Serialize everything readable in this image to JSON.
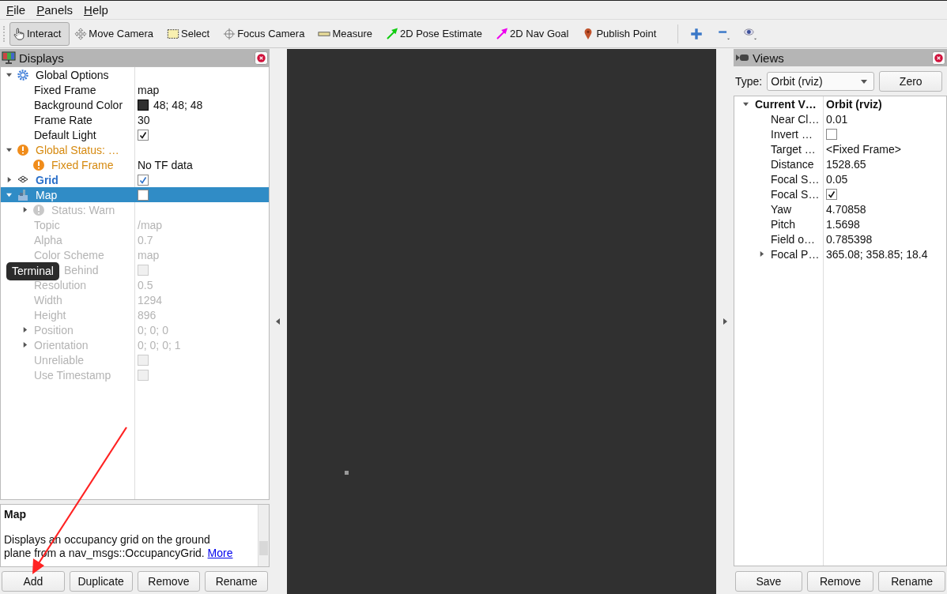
{
  "menu": [
    "File",
    "Panels",
    "Help"
  ],
  "toolbar": {
    "tools": [
      {
        "label": "Interact",
        "selected": true
      },
      {
        "label": "Move Camera",
        "selected": false
      },
      {
        "label": "Select",
        "selected": false
      },
      {
        "label": "Focus Camera",
        "selected": false
      },
      {
        "label": "Measure",
        "selected": false
      },
      {
        "label": "2D Pose Estimate",
        "selected": false
      },
      {
        "label": "2D Nav Goal",
        "selected": false
      },
      {
        "label": "Publish Point",
        "selected": false
      }
    ]
  },
  "displays_panel": {
    "title": "Displays",
    "tree": [
      {
        "kind": "group",
        "label": "Global Options",
        "expanded": true,
        "children": [
          {
            "kind": "property",
            "label": "Fixed Frame",
            "value": "map"
          },
          {
            "kind": "property",
            "label": "Background Color",
            "value": "48; 48; 48",
            "color": "#303030"
          },
          {
            "kind": "property",
            "label": "Frame Rate",
            "value": "30"
          },
          {
            "kind": "property",
            "label": "Default Light",
            "checked": true
          }
        ]
      },
      {
        "kind": "status",
        "label": "Global Status: …",
        "expanded": true,
        "children": [
          {
            "kind": "status",
            "label": "Fixed Frame",
            "value": "No TF data"
          }
        ]
      },
      {
        "kind": "grid",
        "label": "Grid",
        "expanded": false,
        "checked": true,
        "selected": false
      },
      {
        "kind": "map",
        "label": "Map",
        "expanded": true,
        "checked": false,
        "selected": true,
        "children": [
          {
            "kind": "status",
            "label": "Status: Warn",
            "expanded": false,
            "disabled": true
          },
          {
            "kind": "property",
            "label": "Topic",
            "value": "/map",
            "disabled": true
          },
          {
            "kind": "property",
            "label": "Alpha",
            "value": "0.7",
            "disabled": true
          },
          {
            "kind": "property",
            "label": "Color Scheme",
            "value": "map",
            "disabled": true
          },
          {
            "kind": "property",
            "label": "Behind",
            "checked": false,
            "disabled": true,
            "tooltip": "Terminal"
          },
          {
            "kind": "property",
            "label": "Resolution",
            "value": "0.5",
            "disabled": true
          },
          {
            "kind": "property",
            "label": "Width",
            "value": "1294",
            "disabled": true
          },
          {
            "kind": "property",
            "label": "Height",
            "value": "896",
            "disabled": true
          },
          {
            "kind": "property",
            "label": "Position",
            "value": "0; 0; 0",
            "expanded": false,
            "disabled": true
          },
          {
            "kind": "property",
            "label": "Orientation",
            "value": "0; 0; 0; 1",
            "expanded": false,
            "disabled": true
          },
          {
            "kind": "property",
            "label": "Unreliable",
            "checked": false,
            "disabled": true
          },
          {
            "kind": "property",
            "label": "Use Timestamp",
            "checked": false,
            "disabled": true
          }
        ]
      }
    ],
    "description": {
      "title": "Map",
      "text": "Displays an occupancy grid on the ground plane from a nav_msgs::OccupancyGrid.",
      "link": "More"
    },
    "buttons": [
      "Add",
      "Duplicate",
      "Remove",
      "Rename"
    ]
  },
  "views_panel": {
    "title": "Views",
    "type_label": "Type:",
    "type_value": "Orbit (rviz)",
    "zero_button": "Zero",
    "tree": [
      {
        "kind": "view",
        "label": "Current V…",
        "value": "Orbit (rviz)",
        "expanded": true,
        "children": [
          {
            "kind": "property",
            "label": "Near Cl…",
            "value": "0.01"
          },
          {
            "kind": "property",
            "label": "Invert …",
            "checked": false
          },
          {
            "kind": "property",
            "label": "Target …",
            "value": "<Fixed Frame>"
          },
          {
            "kind": "property",
            "label": "Distance",
            "value": "1528.65"
          },
          {
            "kind": "property",
            "label": "Focal S…",
            "value": "0.05"
          },
          {
            "kind": "property",
            "label": "Focal S…",
            "checked": true
          },
          {
            "kind": "property",
            "label": "Yaw",
            "value": "4.70858"
          },
          {
            "kind": "property",
            "label": "Pitch",
            "value": "1.5698"
          },
          {
            "kind": "property",
            "label": "Field o…",
            "value": "0.785398"
          },
          {
            "kind": "property",
            "label": "Focal P…",
            "value": "365.08; 358.85; 18.4",
            "expanded": false
          }
        ]
      }
    ],
    "buttons": [
      "Save",
      "Remove",
      "Rename"
    ]
  }
}
